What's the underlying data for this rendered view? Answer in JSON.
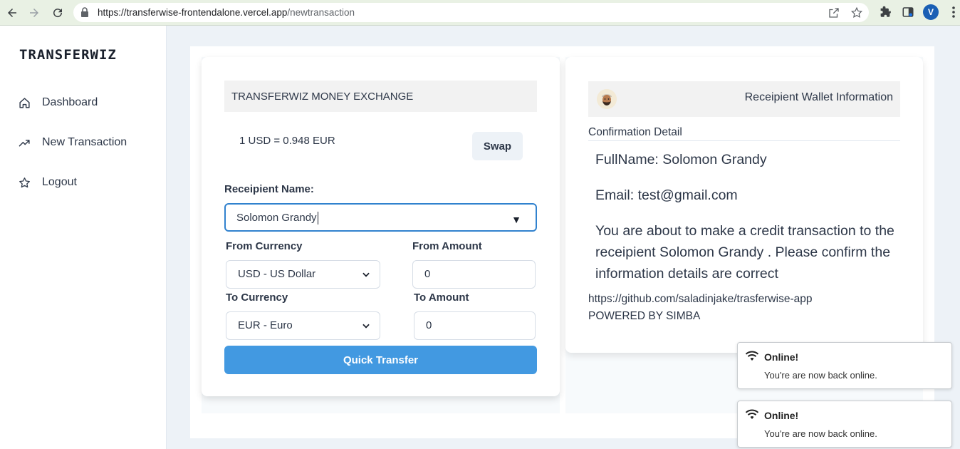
{
  "browser": {
    "url_host": "https://transferwise-frontendalone.vercel.app",
    "url_path": "/newtransaction",
    "profile_initial": "V"
  },
  "sidebar": {
    "brand": "TRANSFERWIZ",
    "items": [
      {
        "label": "Dashboard",
        "icon": "home-icon"
      },
      {
        "label": "New Transaction",
        "icon": "trending-up-icon"
      },
      {
        "label": "Logout",
        "icon": "star-icon"
      }
    ]
  },
  "exchange": {
    "header": "TRANSFERWIZ MONEY EXCHANGE",
    "rate": "1 USD = 0.948 EUR",
    "swap_label": "Swap",
    "recipient_label": "Receipient Name:",
    "recipient_value": "Solomon Grandy",
    "from_currency_label": "From Currency",
    "from_currency_value": "USD - US Dollar",
    "from_amount_label": "From Amount",
    "from_amount_value": "0",
    "to_currency_label": "To Currency",
    "to_currency_value": "EUR - Euro",
    "to_amount_label": "To Amount",
    "to_amount_value": "0",
    "submit_label": "Quick Transfer"
  },
  "wallet": {
    "title": "Receipient Wallet Information",
    "confirmation_title": "Confirmation Detail",
    "fullname": "FullName: Solomon Grandy",
    "email": "Email: test@gmail.com",
    "message": "You are about to make a credit transaction to the receipient Solomon Grandy . Please confirm the information details are correct",
    "link": "https://github.com/saladinjake/trasferwise-app",
    "powered": "POWERED BY SIMBA"
  },
  "toasts": [
    {
      "title": "Online!",
      "message": "You're are now back online."
    },
    {
      "title": "Online!",
      "message": "You're are now back online."
    }
  ],
  "colors": {
    "primary": "#4299e1",
    "focus_border": "#3182ce",
    "chrome_bg": "#e9f1e4"
  }
}
